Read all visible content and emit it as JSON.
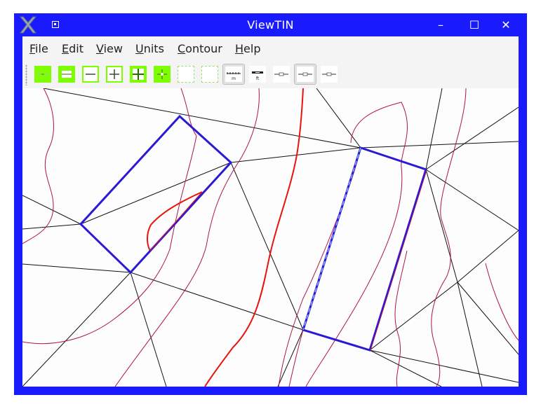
{
  "window": {
    "title": "ViewTIN"
  },
  "window_controls": {
    "minimize": "–",
    "maximize": "☐",
    "close": "✕"
  },
  "menu": {
    "items": [
      {
        "id": "file",
        "mnemonic": "F",
        "rest": "ile"
      },
      {
        "id": "edit",
        "mnemonic": "E",
        "rest": "dit"
      },
      {
        "id": "view",
        "mnemonic": "V",
        "rest": "iew"
      },
      {
        "id": "units",
        "mnemonic": "U",
        "rest": "nits"
      },
      {
        "id": "contour",
        "mnemonic": "C",
        "rest": "ontour"
      },
      {
        "id": "help",
        "mnemonic": "H",
        "rest": "elp"
      }
    ]
  },
  "toolbar": {
    "buttons": [
      {
        "name": "zoom-fit-icon",
        "style": "green"
      },
      {
        "name": "zoom-in-icon",
        "style": "green"
      },
      {
        "name": "zoom-out-icon",
        "style": "green-outline"
      },
      {
        "name": "zoom-plus-icon",
        "style": "green-outline"
      },
      {
        "name": "zoom-plus-bold-icon",
        "style": "green"
      },
      {
        "name": "pan-icon",
        "style": "green"
      },
      {
        "name": "blank-1-icon",
        "style": "green-dash"
      },
      {
        "name": "blank-2-icon",
        "style": "green-dash"
      },
      {
        "name": "scale-meters-icon",
        "style": "pressed",
        "sub": "m"
      },
      {
        "name": "scale-feet-icon",
        "style": "white",
        "sub": "ft"
      },
      {
        "name": "scale-line-1-icon",
        "style": "white"
      },
      {
        "name": "scale-line-2-icon",
        "style": "pressed"
      },
      {
        "name": "scale-line-3-icon",
        "style": "white"
      }
    ]
  },
  "colors": {
    "frame": "#1a1aff",
    "tin_edge": "#111111",
    "contour": "#b0124a",
    "contour_bright": "#e8140e",
    "breakline": "#2a1ad6",
    "accent_green": "#7dff00"
  }
}
